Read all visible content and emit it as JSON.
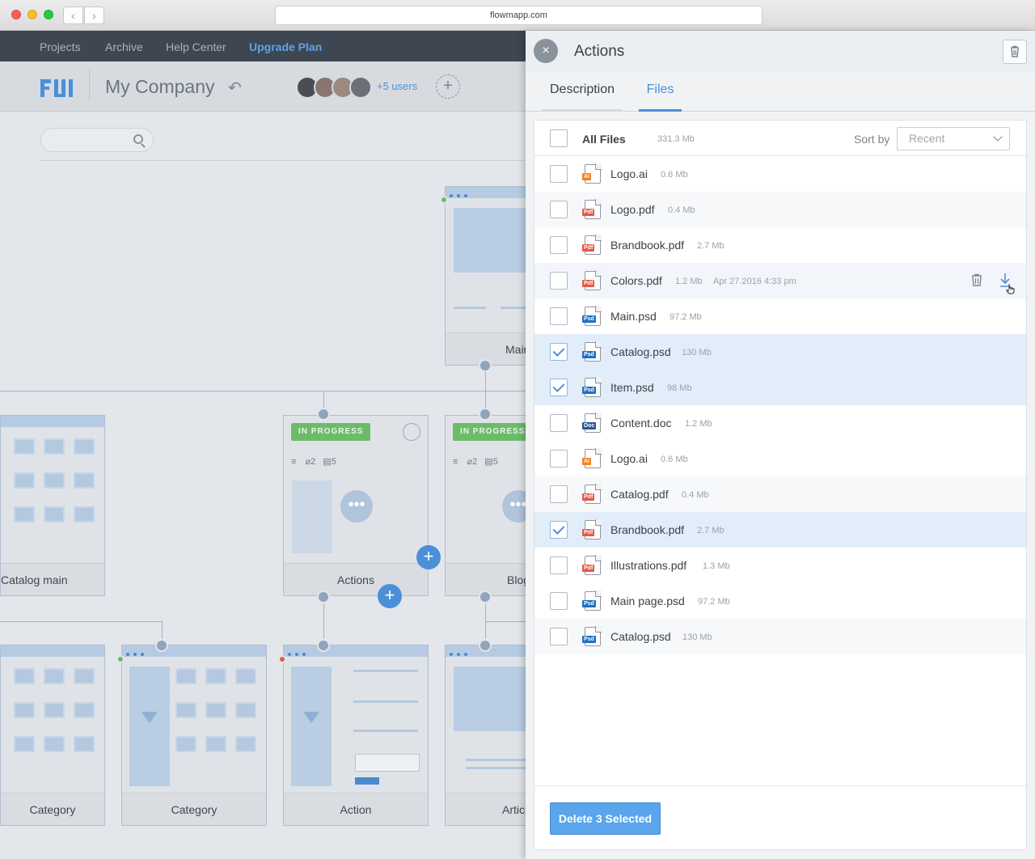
{
  "browser": {
    "url": "flowmapp.com"
  },
  "topnav": {
    "projects": "Projects",
    "archive": "Archive",
    "help": "Help Center",
    "upgrade": "Upgrade Plan"
  },
  "header": {
    "logo": "FM",
    "company": "My Company",
    "users_more": "+5 users"
  },
  "sitemap": {
    "status": "IN PROGRESS",
    "attachments": "2",
    "comments": "5",
    "cards": {
      "catalog_main": "Catalog main",
      "main": "Main",
      "actions": "Actions",
      "blog": "Blog",
      "category1": "Category",
      "category2": "Category",
      "action": "Action",
      "article": "Article"
    }
  },
  "panel": {
    "title": "Actions",
    "tabs": {
      "description": "Description",
      "files": "Files"
    },
    "all_files": "All Files",
    "total_size": "331.3 Mb",
    "sort_label": "Sort by",
    "sort_value": "Recent",
    "files": [
      {
        "name": "Logo.ai",
        "size": "0.6 Mb",
        "type": "Ai",
        "checked": false
      },
      {
        "name": "Logo.pdf",
        "size": "0.4 Mb",
        "type": "Pdf",
        "checked": false
      },
      {
        "name": "Brandbook.pdf",
        "size": "2.7 Mb",
        "type": "Pdf",
        "checked": false
      },
      {
        "name": "Colors.pdf",
        "size": "1.2 Mb",
        "date": "Apr 27.2016 4:33 pm",
        "type": "Pdf",
        "checked": false
      },
      {
        "name": "Main.psd",
        "size": "97.2 Mb",
        "type": "Psd",
        "checked": false
      },
      {
        "name": "Catalog.psd",
        "size": "130 Mb",
        "type": "Psd",
        "checked": true
      },
      {
        "name": "Item.psd",
        "size": "98 Mb",
        "type": "Psd",
        "checked": true
      },
      {
        "name": "Content.doc",
        "size": "1.2 Mb",
        "type": "Doc",
        "checked": false
      },
      {
        "name": "Logo.ai",
        "size": "0.6 Mb",
        "type": "Ai",
        "checked": false
      },
      {
        "name": "Catalog.pdf",
        "size": "0.4 Mb",
        "type": "Pdf",
        "checked": false
      },
      {
        "name": "Brandbook.pdf",
        "size": "2.7 Mb",
        "type": "Pdf",
        "checked": true
      },
      {
        "name": "Illustrations.pdf",
        "size": "1.3 Mb",
        "type": "Pdf",
        "checked": false
      },
      {
        "name": "Main page.psd",
        "size": "97.2 Mb",
        "type": "Psd",
        "checked": false
      },
      {
        "name": "Catalog.psd",
        "size": "130 Mb",
        "type": "Psd",
        "checked": false
      }
    ],
    "delete_button": "Delete 3 Selected"
  },
  "colors": {
    "accent": "#4a90d9",
    "ai": "#f58220",
    "pdf": "#e8564a",
    "psd": "#1f6fc1",
    "doc": "#2b5797",
    "progress": "#6dbb6a"
  }
}
